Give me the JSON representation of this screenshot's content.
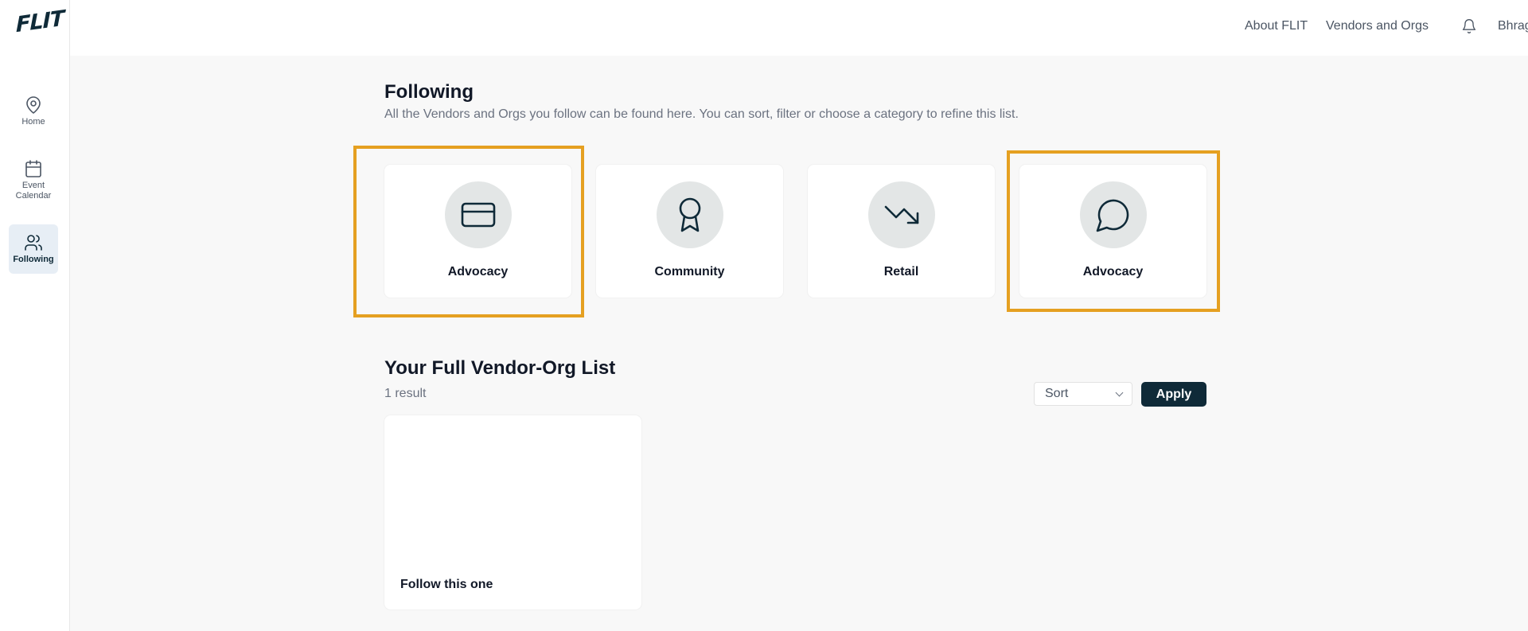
{
  "app": {
    "logo": "FLIT"
  },
  "sidebar": {
    "items": [
      {
        "label": "Home",
        "icon": "map-pin-icon"
      },
      {
        "label": "Event Calendar",
        "icon": "calendar-icon"
      },
      {
        "label": "Following",
        "icon": "users-icon",
        "active": true
      }
    ]
  },
  "topbar": {
    "links": [
      "About FLIT",
      "Vendors and Orgs"
    ],
    "notification_icon": "bell-icon",
    "username": "Bhragan"
  },
  "page": {
    "title": "Following",
    "subtitle": "All the Vendors and Orgs you follow can be found here. You can sort, filter or choose a category to refine this list."
  },
  "categories": [
    {
      "label": "Advocacy",
      "icon": "credit-card-icon",
      "highlighted": true
    },
    {
      "label": "Community",
      "icon": "award-icon",
      "highlighted": false
    },
    {
      "label": "Retail",
      "icon": "trending-down-icon",
      "highlighted": false
    },
    {
      "label": "Advocacy",
      "icon": "message-circle-icon",
      "highlighted": true
    }
  ],
  "list": {
    "title": "Your Full Vendor-Org List",
    "result_count": "1 result",
    "sort_label": "Sort",
    "apply_label": "Apply",
    "items": [
      {
        "name": "Follow this one"
      }
    ]
  },
  "colors": {
    "accent": "#0f2a38",
    "highlight": "#e5a021",
    "background": "#f8f8f8",
    "icon_circle": "#e3e6e6"
  }
}
